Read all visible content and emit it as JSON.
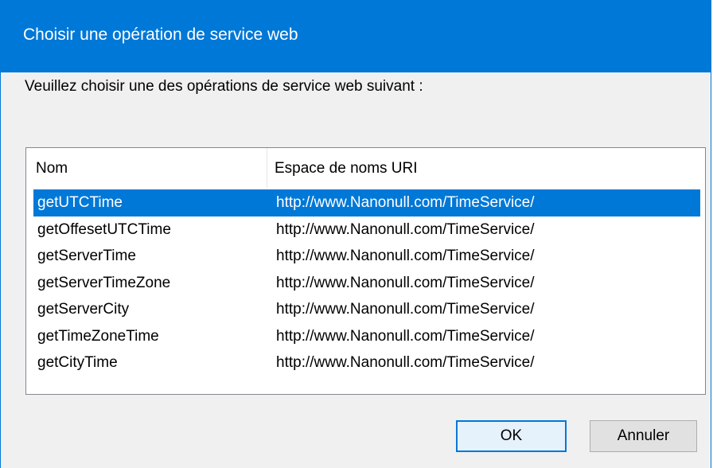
{
  "dialog": {
    "title": "Choisir une opération de service web",
    "prompt": "Veuillez choisir une des opérations de service web suivant :"
  },
  "list": {
    "columns": {
      "name": "Nom",
      "namespace": "Espace de noms URI"
    },
    "rows": [
      {
        "name": "getUTCTime",
        "namespace": "http://www.Nanonull.com/TimeService/",
        "selected": true
      },
      {
        "name": "getOffesetUTCTime",
        "namespace": "http://www.Nanonull.com/TimeService/"
      },
      {
        "name": "getServerTime",
        "namespace": "http://www.Nanonull.com/TimeService/"
      },
      {
        "name": "getServerTimeZone",
        "namespace": "http://www.Nanonull.com/TimeService/"
      },
      {
        "name": "getServerCity",
        "namespace": "http://www.Nanonull.com/TimeService/"
      },
      {
        "name": "getTimeZoneTime",
        "namespace": "http://www.Nanonull.com/TimeService/"
      },
      {
        "name": "getCityTime",
        "namespace": "http://www.Nanonull.com/TimeService/"
      }
    ]
  },
  "buttons": {
    "ok": "OK",
    "cancel": "Annuler"
  },
  "colors": {
    "accent": "#0078d7",
    "background": "#f0f0f0"
  }
}
